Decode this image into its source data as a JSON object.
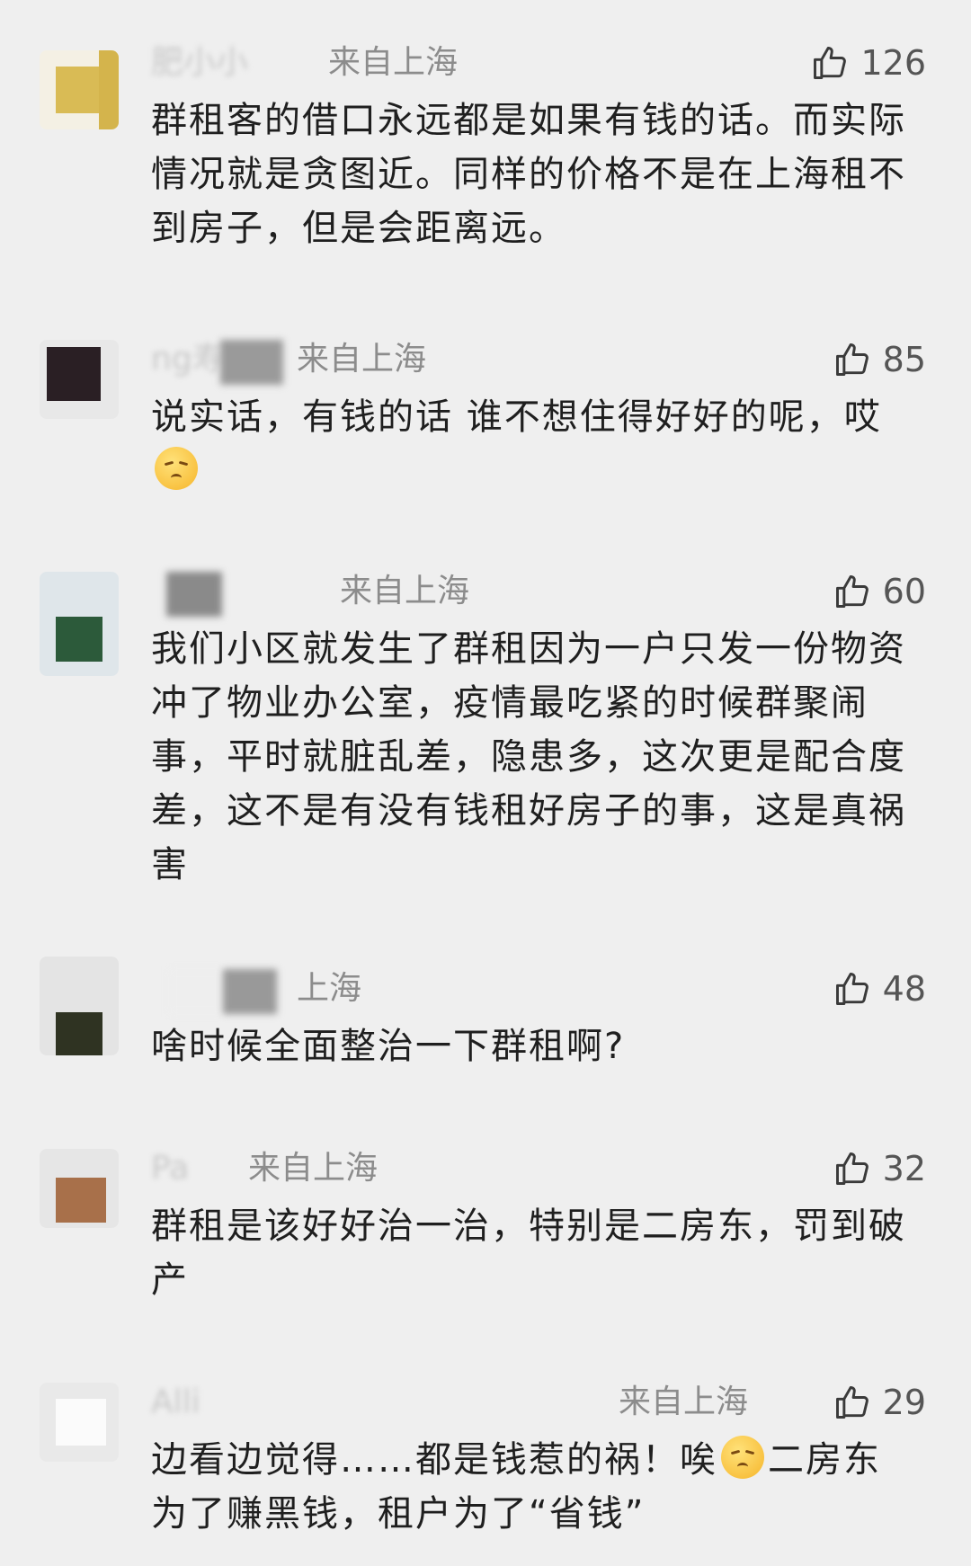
{
  "comments": [
    {
      "name": "肥小小",
      "location": "来自上海",
      "likes": "126",
      "text": "群租客的借口永远都是如果有钱的话。而实际情况就是贪图近。同样的价格不是在上海租不到房子，但是会距离远。"
    },
    {
      "name": "ng寿",
      "location": "来自上海",
      "likes": "85",
      "text": "说实话，有钱的话 谁不想住得好好的呢，哎",
      "emoji": "worried-face-emoji"
    },
    {
      "name": "",
      "location": "来自上海",
      "likes": "60",
      "text": "我们小区就发生了群租因为一户只发一份物资冲了物业办公室，疫情最吃紧的时候群聚闹事，平时就脏乱差，隐患多，这次更是配合度差，这不是有没有钱租好房子的事，这是真祸害"
    },
    {
      "name": "",
      "location": "上海",
      "likes": "48",
      "text": "啥时候全面整治一下群租啊?"
    },
    {
      "name": "Pa",
      "location": "来自上海",
      "likes": "32",
      "text": "群租是该好好治一治，特别是二房东，罚到破产"
    },
    {
      "name": "Alli",
      "location": "来自上海",
      "likes": "29",
      "text_before": "边看边觉得……都是钱惹的祸！唉",
      "text_after": "二房东为了赚黑钱，租户为了“省钱”",
      "emoji": "worried-face-emoji"
    }
  ]
}
